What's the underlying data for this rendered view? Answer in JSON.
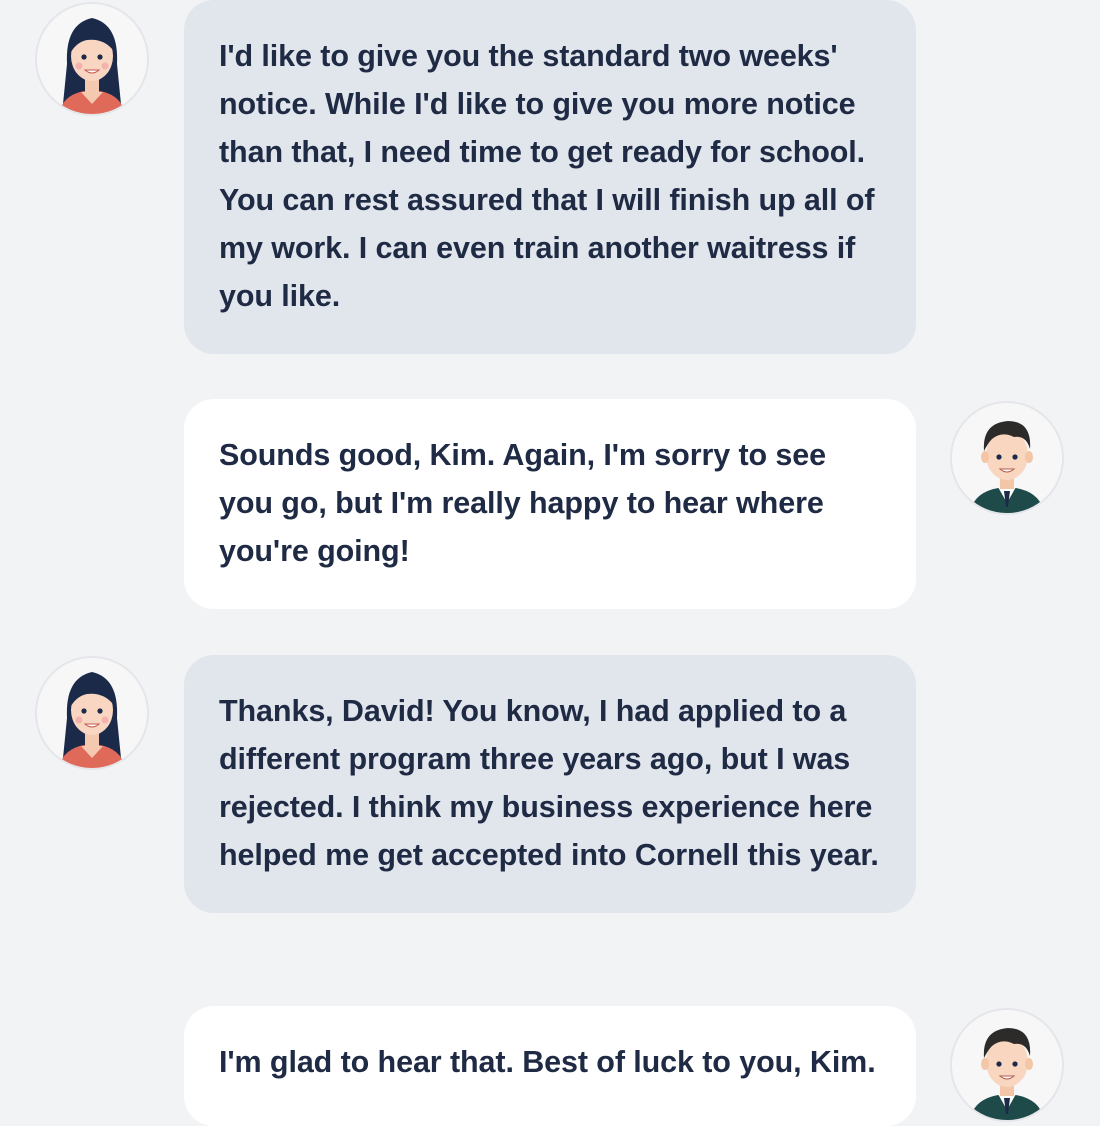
{
  "conversation": {
    "messages": [
      {
        "speaker": "Kim",
        "avatar_icon": "woman-avatar-icon",
        "text": "I'd like to give you the standard two weeks' notice. While I'd like to give you more notice than that, I need time to get ready for school. You can rest assured that I will finish up all of my work. I can even train another waitress if you like."
      },
      {
        "speaker": "David",
        "avatar_icon": "man-avatar-icon",
        "text": "Sounds good, Kim. Again, I'm sorry to see you go, but I'm really happy to hear where you're going!"
      },
      {
        "speaker": "Kim",
        "avatar_icon": "woman-avatar-icon",
        "text": "Thanks, David! You know, I had applied to a different program three years ago, but I was rejected. I think my business experience here helped me get accepted into Cornell this year."
      },
      {
        "speaker": "David",
        "avatar_icon": "man-avatar-icon",
        "text": "I'm glad to hear that. Best of luck to you, Kim."
      }
    ]
  },
  "colors": {
    "background": "#f2f3f5",
    "incoming_bubble": "#e1e5ec",
    "outgoing_bubble": "#ffffff",
    "text": "#1f2a44"
  }
}
